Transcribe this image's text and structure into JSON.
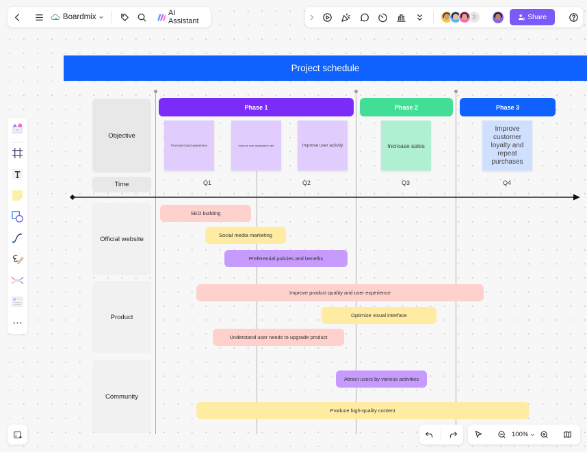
{
  "top_left_toolbar": {
    "back_icon": "chevron-left-icon",
    "menu_icon": "hamburger-icon",
    "app_name": "Boardmix",
    "tag_icon": "tag-icon",
    "search_icon": "search-icon",
    "ai_label": "AI Assistant"
  },
  "top_right_toolbar": {
    "icons": [
      "chevron-right-icon",
      "present-icon",
      "celebrate-icon",
      "comment-icon",
      "timer-icon",
      "vote-icon",
      "more-icon"
    ],
    "collaborator_count": "3",
    "share_label": "Share",
    "help_icon": "help-icon"
  },
  "left_toolbar": {
    "items": [
      "templates",
      "frame",
      "text",
      "sticky-note",
      "shape",
      "connector",
      "pen",
      "mind-map",
      "table",
      "more"
    ]
  },
  "board": {
    "title": "Project schedule",
    "row_labels": {
      "objective": "Objective",
      "time": "Time",
      "official_website": "Official website",
      "product": "Product",
      "community": "Community"
    },
    "phases": [
      {
        "label": "Phase 1",
        "color": "#7b2cf8"
      },
      {
        "label": "Phase 2",
        "color": "#43de95"
      },
      {
        "label": "Phase 3",
        "color": "#0f62fe"
      }
    ],
    "objectives": [
      {
        "text": "Promote brand awareness",
        "color": "#e1cdfd"
      },
      {
        "text": "Improve user registration rate",
        "color": "#e1cdfd"
      },
      {
        "text": "Improve user activity",
        "color": "#e1cdfd"
      },
      {
        "text": "Increase sales",
        "color": "#aff0d2"
      },
      {
        "text": "Improve customer loyalty and repeat purchases",
        "color": "#cfe0ff"
      }
    ],
    "quarters": [
      "Q1",
      "Q2",
      "Q3",
      "Q4"
    ],
    "tasks": {
      "official_website": [
        {
          "text": "SEO building",
          "color": "#ffd1cc"
        },
        {
          "text": "Social media marketing",
          "color": "#ffeba2"
        },
        {
          "text": "Preferential policies and benefits",
          "color": "#c79bfd"
        }
      ],
      "product": [
        {
          "text": "Improve product quality and user experience",
          "color": "#ffd1cc"
        },
        {
          "text": "Optimize visual interface",
          "color": "#ffeba2"
        },
        {
          "text": "Understand user needs to upgrade product",
          "color": "#ffd1cc"
        }
      ],
      "community": [
        {
          "text": "Attract users by various activities",
          "color": "#c79bfd"
        },
        {
          "text": "Produce high-quality content",
          "color": "#ffeba2"
        }
      ]
    }
  },
  "bottom_toolbar": {
    "undo_icon": "undo-icon",
    "redo_icon": "redo-icon",
    "select_icon": "cursor-icon",
    "zoom_out_icon": "zoom-out-icon",
    "zoom_level": "100%",
    "zoom_in_icon": "zoom-in-icon",
    "minimap_icon": "map-icon"
  },
  "bottom_left": {
    "icon": "outline-icon"
  }
}
